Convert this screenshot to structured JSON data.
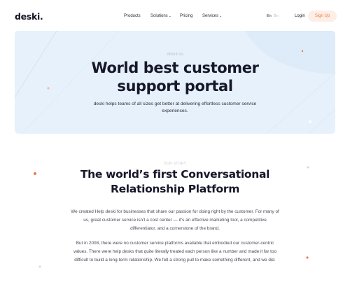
{
  "brand": {
    "logo": "deski."
  },
  "nav": {
    "items": [
      {
        "label": "Products",
        "caret": ""
      },
      {
        "label": "Solutions",
        "caret": "⌄"
      },
      {
        "label": "Pricing",
        "caret": ""
      },
      {
        "label": "Services",
        "caret": "⌄"
      }
    ],
    "lang_en": "En",
    "lang_bn": "Bn",
    "login": "Login",
    "signup": "Sign Up"
  },
  "hero": {
    "eyebrow": "About us",
    "title_line1": "World best customer",
    "title_line2": "support portal",
    "subtitle": "deski helps teams of all sizes get better at delivering effortless customer service experiences."
  },
  "story": {
    "eyebrow": "OUR STORY",
    "title_line1": "The world’s first Conversational",
    "title_line2": "Relationship Platform",
    "paragraph1": "We created Help deski for businesses that share our passion for doing right by the customer. For many of us, great customer service isn’t a cost center — it’s an effective marketing tool, a competitive differentiator, and a cornerstone of the brand.",
    "paragraph2": "But in 2008, there were no customer service platforms available that embodied our customer-centric values. There were help desks that quite literally treated each person like  a number and made it far too difficult to build a long-term relationship. We felt a strong pull to make something different, and we did."
  },
  "colors": {
    "accent": "#f07b4e",
    "hero_bg": "#e6f1fb",
    "title": "#17172a"
  }
}
